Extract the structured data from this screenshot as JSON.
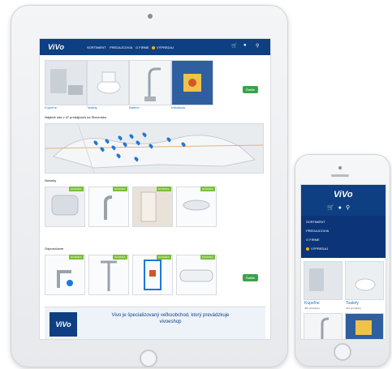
{
  "tablet": {
    "brand": "ViVo",
    "nav": {
      "items": [
        "SORTIMENT",
        "PREDAJCOVIA",
        "O FIRME",
        "VÝPREDAJ"
      ],
      "icons": [
        "cart-icon",
        "user-icon",
        "search-icon"
      ]
    },
    "categories": [
      {
        "label": "Kúpeľne"
      },
      {
        "label": "Toalety"
      },
      {
        "label": "Batérie"
      },
      {
        "label": "Inštalácia"
      }
    ],
    "category_button": "Ďalšie",
    "stores_heading": "Nájdete nás v 47 predajňach na Slovensku",
    "news_heading": "Novinky",
    "featured_heading": "Odporúčame",
    "new_badge": "NOVINKA",
    "featured_button": "Ďalšie",
    "promo_text": "Vivo je špecializovaný veľkoobchod, ktorý prevádzkuje vivoeshop",
    "promo_logo": "ViVo"
  },
  "phone": {
    "brand": "ViVo",
    "menu": [
      "SORTIMENT",
      "PREDAJCOVIA",
      "O FIRME",
      "VÝPREDAJ"
    ],
    "tiles": [
      {
        "label": "Kúpeľne",
        "sub": "450 produktov"
      },
      {
        "label": "Toalety",
        "sub": "321 produktov"
      }
    ]
  }
}
